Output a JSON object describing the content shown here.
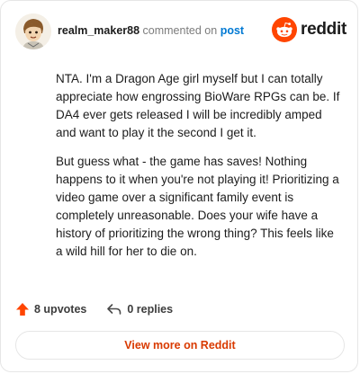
{
  "header": {
    "username": "realm_maker88",
    "commented_text": "commented on",
    "post_link": "post",
    "brand": "reddit"
  },
  "comment": {
    "paragraphs": [
      "NTA. I'm a Dragon Age girl myself but I can totally appreciate how engrossing BioWare RPGs can be. If DA4 ever gets released I will be incredibly amped and want to play it the second I get it.",
      "But guess what - the game has saves! Nothing happens to it when you're not playing it! Prioritizing a video game over a significant family event is completely unreasonable. Does your wife have a history of prioritizing the wrong thing? This feels like a wild hill for her to die on."
    ]
  },
  "actions": {
    "upvotes": "8 upvotes",
    "replies": "0 replies"
  },
  "footer": {
    "view_more": "View more on Reddit"
  },
  "colors": {
    "brand_orange": "#ff4500",
    "link_blue": "#0079d3",
    "view_more_text": "#d93a00"
  },
  "icons": {
    "avatar": "cartoon-avatar-icon",
    "reddit": "reddit-snoo-icon",
    "upvote": "upvote-arrow-icon",
    "reply": "reply-arrow-icon"
  }
}
